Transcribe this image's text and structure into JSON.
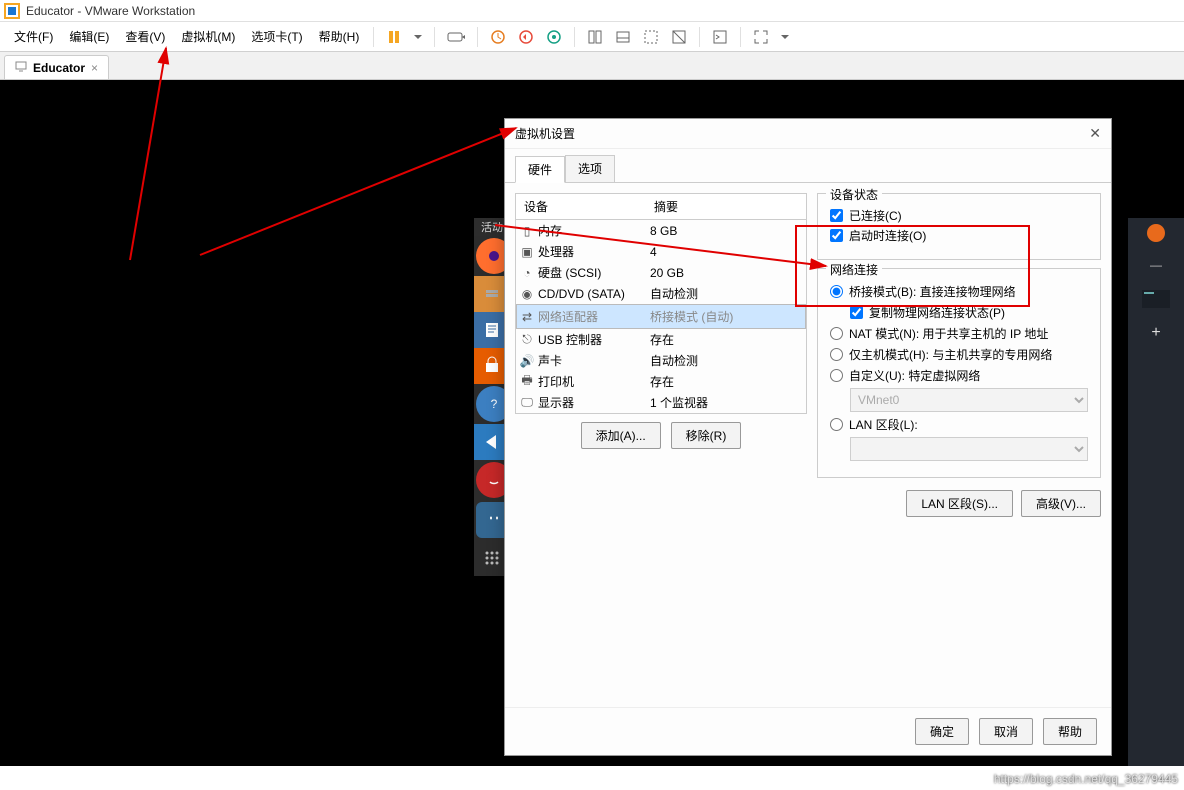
{
  "window": {
    "title": "Educator - VMware Workstation"
  },
  "menu": {
    "file": "文件(F)",
    "edit": "编辑(E)",
    "view": "查看(V)",
    "vm": "虚拟机(M)",
    "tabs": "选项卡(T)",
    "help": "帮助(H)"
  },
  "tab": {
    "name": "Educator"
  },
  "dialog": {
    "title": "虚拟机设置",
    "tab_hw": "硬件",
    "tab_opt": "选项",
    "col_device": "设备",
    "col_summary": "摘要",
    "rows": [
      {
        "dev": "内存",
        "sum": "8 GB"
      },
      {
        "dev": "处理器",
        "sum": "4"
      },
      {
        "dev": "硬盘 (SCSI)",
        "sum": "20 GB"
      },
      {
        "dev": "CD/DVD (SATA)",
        "sum": "自动检测"
      },
      {
        "dev": "网络适配器",
        "sum": "桥接模式 (自动)"
      },
      {
        "dev": "USB 控制器",
        "sum": "存在"
      },
      {
        "dev": "声卡",
        "sum": "自动检测"
      },
      {
        "dev": "打印机",
        "sum": "存在"
      },
      {
        "dev": "显示器",
        "sum": "1 个监视器"
      }
    ],
    "add": "添加(A)...",
    "remove": "移除(R)",
    "state_legend": "设备状态",
    "connected": "已连接(C)",
    "connect_on": "启动时连接(O)",
    "net_legend": "网络连接",
    "bridged": "桥接模式(B): 直接连接物理网络",
    "replicate": "复制物理网络连接状态(P)",
    "nat": "NAT 模式(N): 用于共享主机的 IP 地址",
    "host": "仅主机模式(H): 与主机共享的专用网络",
    "custom": "自定义(U): 特定虚拟网络",
    "custom_val": "VMnet0",
    "lan": "LAN 区段(L):",
    "lan_btn": "LAN 区段(S)...",
    "adv_btn": "高级(V)...",
    "ok": "确定",
    "cancel": "取消",
    "helpb": "帮助"
  },
  "watermark": "https://blog.csdn.net/qq_36279445",
  "dock_head": "活动"
}
